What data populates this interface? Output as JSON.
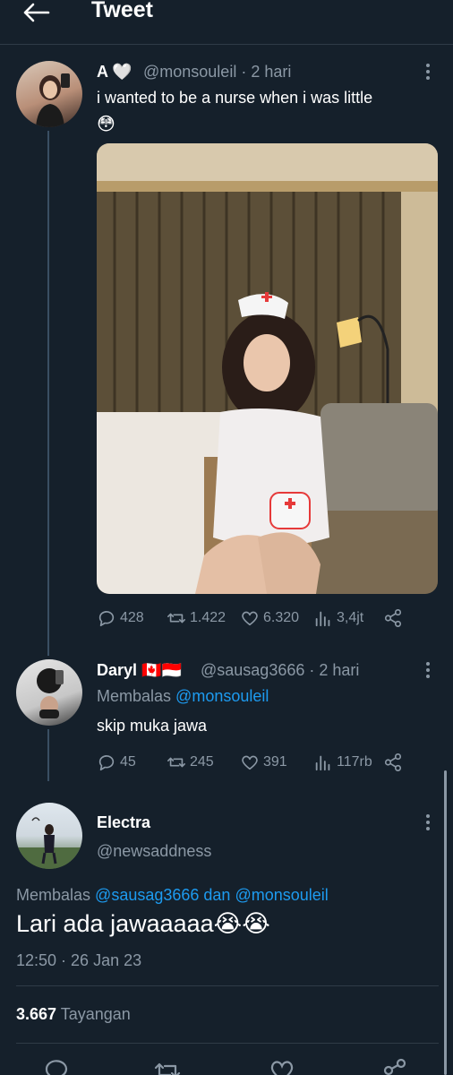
{
  "header": {
    "title": "Tweet"
  },
  "tweet1": {
    "name": "A 🤍",
    "handle_time": "@monsouleil · 2 hari",
    "text": "i wanted to be a nurse when i was little",
    "emoji": "😳",
    "stats": {
      "replies": "428",
      "retweets": "1.422",
      "likes": "6.320",
      "views": "3,4jt"
    }
  },
  "tweet2": {
    "name": "Daryl 🇨🇦🇮🇩",
    "handle_time": "@sausag3666 · 2 hari",
    "reply_prefix": "Membalas",
    "reply_to": "@monsouleil",
    "text": "skip muka jawa",
    "stats": {
      "replies": "45",
      "retweets": "245",
      "likes": "391",
      "views": "117rb"
    }
  },
  "tweet3": {
    "name": "Electra",
    "handle": "@newsaddness",
    "reply_prefix": "Membalas",
    "reply_to": "@sausag3666 dan @monsouleil",
    "text": "Lari ada jawaaaaa😭😭",
    "timestamp": "12:50 · 26 Jan 23",
    "views_count": "3.667",
    "views_label": "Tayangan"
  },
  "colors": {
    "background": "#15202b",
    "accent": "#1d9bf0",
    "muted": "#8b98a5"
  }
}
